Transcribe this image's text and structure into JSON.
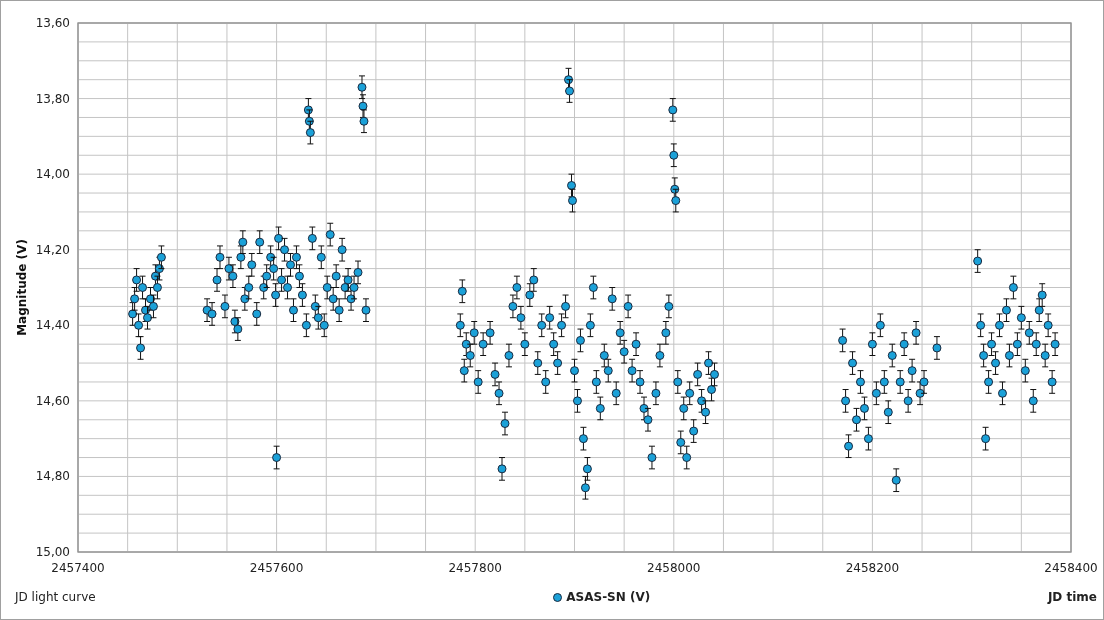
{
  "chart": {
    "caption": "JD light curve",
    "chart_data": {
      "type": "scatter",
      "grid": true,
      "xlabel": "JD time",
      "ylabel": "Magnitude (V)",
      "xlim": [
        2457400,
        2458400
      ],
      "ylim": [
        15.0,
        13.6
      ],
      "xticks": [
        2457400,
        2457600,
        2457800,
        2458000,
        2458200,
        2458400
      ],
      "yticks": [
        {
          "value": 13.6,
          "label": "13,60"
        },
        {
          "value": 13.8,
          "label": "13,80"
        },
        {
          "value": 14.0,
          "label": "14,00"
        },
        {
          "value": 14.2,
          "label": "14,20"
        },
        {
          "value": 14.4,
          "label": "14,40"
        },
        {
          "value": 14.6,
          "label": "14,60"
        },
        {
          "value": 14.8,
          "label": "14,80"
        },
        {
          "value": 15.0,
          "label": "15,00"
        }
      ],
      "x": [
        2457455,
        2457457,
        2457459,
        2457461,
        2457463,
        2457465,
        2457468,
        2457470,
        2457473,
        2457476,
        2457478,
        2457480,
        2457482,
        2457484,
        2457530,
        2457535,
        2457540,
        2457543,
        2457548,
        2457552,
        2457556,
        2457558,
        2457561,
        2457564,
        2457566,
        2457568,
        2457572,
        2457575,
        2457580,
        2457583,
        2457587,
        2457590,
        2457594,
        2457597,
        2457599,
        2457600,
        2457602,
        2457605,
        2457608,
        2457611,
        2457614,
        2457617,
        2457620,
        2457623,
        2457626,
        2457630,
        2457632,
        2457633,
        2457634,
        2457636,
        2457639,
        2457642,
        2457645,
        2457648,
        2457651,
        2457654,
        2457657,
        2457660,
        2457663,
        2457666,
        2457669,
        2457672,
        2457675,
        2457678,
        2457682,
        2457686,
        2457687,
        2457688,
        2457690,
        2457785,
        2457787,
        2457789,
        2457791,
        2457795,
        2457799,
        2457803,
        2457808,
        2457815,
        2457820,
        2457824,
        2457827,
        2457830,
        2457834,
        2457838,
        2457842,
        2457846,
        2457850,
        2457855,
        2457859,
        2457863,
        2457867,
        2457871,
        2457875,
        2457879,
        2457883,
        2457887,
        2457891,
        2457894,
        2457895,
        2457897,
        2457898,
        2457900,
        2457903,
        2457906,
        2457909,
        2457911,
        2457913,
        2457916,
        2457919,
        2457922,
        2457926,
        2457930,
        2457934,
        2457938,
        2457942,
        2457946,
        2457950,
        2457954,
        2457958,
        2457962,
        2457966,
        2457970,
        2457974,
        2457978,
        2457982,
        2457986,
        2457992,
        2457995,
        2457999,
        2458000,
        2458001,
        2458002,
        2458004,
        2458007,
        2458010,
        2458013,
        2458016,
        2458020,
        2458024,
        2458028,
        2458032,
        2458035,
        2458038,
        2458041,
        2458170,
        2458173,
        2458176,
        2458180,
        2458184,
        2458188,
        2458192,
        2458196,
        2458200,
        2458204,
        2458208,
        2458212,
        2458216,
        2458220,
        2458224,
        2458228,
        2458232,
        2458236,
        2458240,
        2458244,
        2458248,
        2458252,
        2458265,
        2458306,
        2458309,
        2458312,
        2458314,
        2458317,
        2458320,
        2458324,
        2458328,
        2458331,
        2458335,
        2458338,
        2458342,
        2458346,
        2458350,
        2458354,
        2458358,
        2458362,
        2458365,
        2458368,
        2458371,
        2458374,
        2458377,
        2458381,
        2458384
      ],
      "series": [
        {
          "name": "ASAS-SN (V)",
          "color": "#1ba1d8",
          "values": [
            14.37,
            14.33,
            14.28,
            14.4,
            14.46,
            14.3,
            14.36,
            14.38,
            14.33,
            14.35,
            14.27,
            14.3,
            14.25,
            14.22,
            14.36,
            14.37,
            14.28,
            14.22,
            14.35,
            14.25,
            14.27,
            14.39,
            14.41,
            14.22,
            14.18,
            14.33,
            14.3,
            14.24,
            14.37,
            14.18,
            14.3,
            14.27,
            14.22,
            14.25,
            14.32,
            14.75,
            14.17,
            14.28,
            14.2,
            14.3,
            14.24,
            14.36,
            14.22,
            14.27,
            14.32,
            14.4,
            13.83,
            13.86,
            13.89,
            14.17,
            14.35,
            14.38,
            14.22,
            14.4,
            14.3,
            14.16,
            14.33,
            14.27,
            14.36,
            14.2,
            14.3,
            14.28,
            14.33,
            14.3,
            14.26,
            13.77,
            13.82,
            13.86,
            14.36,
            14.4,
            14.31,
            14.52,
            14.45,
            14.48,
            14.42,
            14.55,
            14.45,
            14.42,
            14.53,
            14.58,
            14.78,
            14.66,
            14.48,
            14.35,
            14.3,
            14.38,
            14.45,
            14.32,
            14.28,
            14.5,
            14.4,
            14.55,
            14.38,
            14.45,
            14.5,
            14.4,
            14.35,
            13.75,
            13.78,
            14.03,
            14.07,
            14.52,
            14.6,
            14.44,
            14.7,
            14.83,
            14.78,
            14.4,
            14.3,
            14.55,
            14.62,
            14.48,
            14.52,
            14.33,
            14.58,
            14.42,
            14.47,
            14.35,
            14.52,
            14.45,
            14.55,
            14.62,
            14.65,
            14.75,
            14.58,
            14.48,
            14.42,
            14.35,
            13.83,
            13.95,
            14.04,
            14.07,
            14.55,
            14.71,
            14.62,
            14.75,
            14.58,
            14.68,
            14.53,
            14.6,
            14.63,
            14.5,
            14.57,
            14.53,
            14.44,
            14.6,
            14.72,
            14.5,
            14.65,
            14.55,
            14.62,
            14.7,
            14.45,
            14.58,
            14.4,
            14.55,
            14.63,
            14.48,
            14.81,
            14.55,
            14.45,
            14.6,
            14.52,
            14.42,
            14.58,
            14.55,
            14.46,
            14.23,
            14.4,
            14.48,
            14.7,
            14.55,
            14.45,
            14.5,
            14.4,
            14.58,
            14.36,
            14.48,
            14.3,
            14.45,
            14.38,
            14.52,
            14.42,
            14.6,
            14.45,
            14.36,
            14.32,
            14.48,
            14.4,
            14.55,
            14.45
          ]
        }
      ]
    }
  }
}
